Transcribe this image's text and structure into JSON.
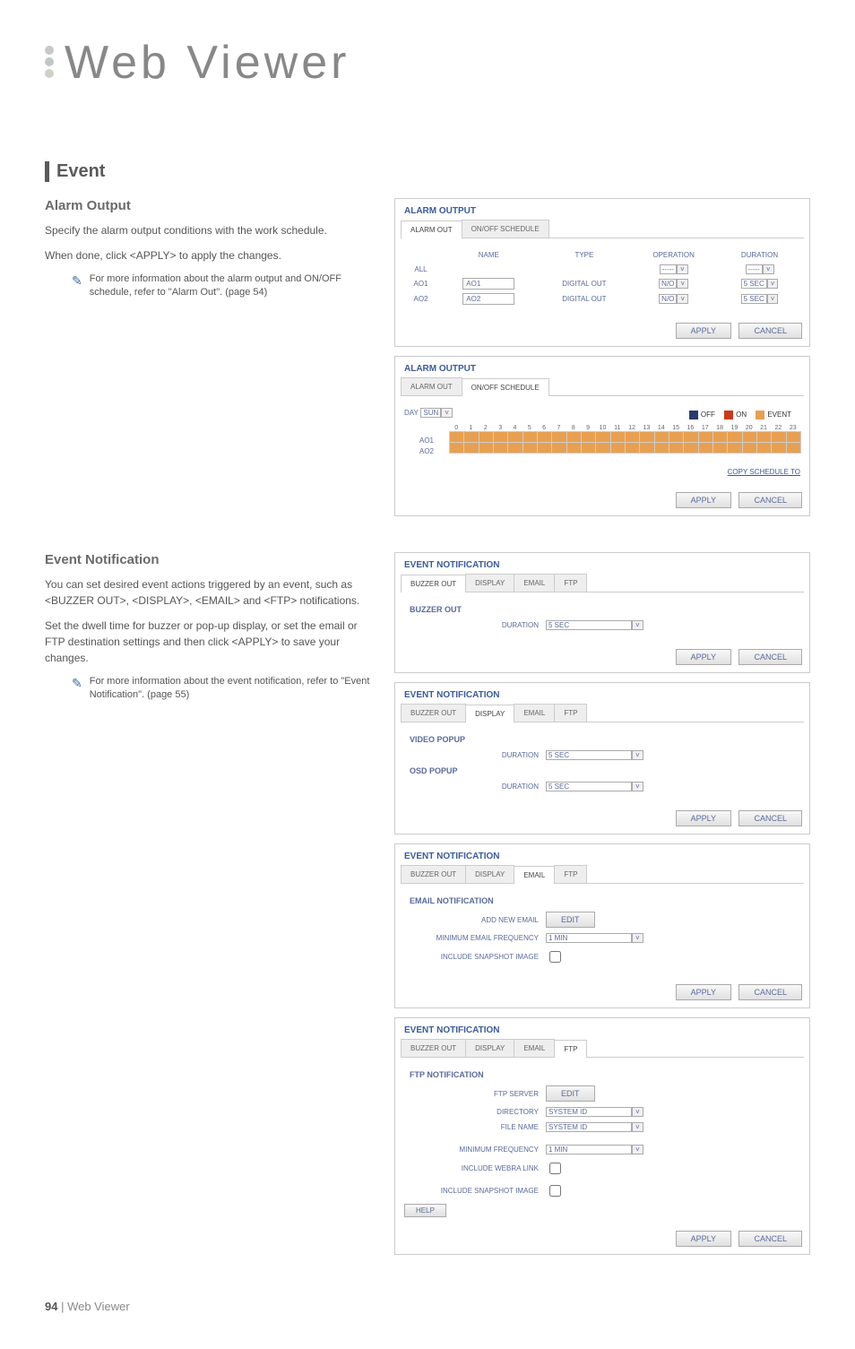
{
  "pageTitle": "Web Viewer",
  "event": {
    "heading": "Event",
    "alarmOutput": {
      "heading": "Alarm Output",
      "para1": "Specify the alarm output conditions with the work schedule.",
      "para2": "When done, click <APPLY> to apply the changes.",
      "note": "For more information about the alarm output and ON/OFF schedule, refer to \"Alarm Out\". (page 54)"
    },
    "eventNotification": {
      "heading": "Event Notification",
      "para1": "You can set desired event actions triggered by an event, such as <BUZZER OUT>, <DISPLAY>, <EMAIL> and <FTP> notifications.",
      "para2": "Set the dwell time for buzzer or pop-up display, or set the email or FTP destination settings and then click <APPLY> to save your changes.",
      "note": "For more information about the event notification, refer to \"Event Notification\". (page 55)"
    }
  },
  "panel1": {
    "title": "ALARM OUTPUT",
    "tabs": [
      "ALARM OUT",
      "ON/OFF SCHEDULE"
    ],
    "cols": [
      "NAME",
      "TYPE",
      "OPERATION",
      "DURATION"
    ],
    "rows": [
      {
        "id": "ALL",
        "name": "",
        "type": "",
        "op": "-----",
        "dur": "-----"
      },
      {
        "id": "AO1",
        "name": "AO1",
        "type": "DIGITAL OUT",
        "op": "N/O",
        "dur": "5 SEC"
      },
      {
        "id": "AO2",
        "name": "AO2",
        "type": "DIGITAL OUT",
        "op": "N/O",
        "dur": "5 SEC"
      }
    ],
    "apply": "APPLY",
    "cancel": "CANCEL"
  },
  "panel2": {
    "title": "ALARM OUTPUT",
    "tabs": [
      "ALARM OUT",
      "ON/OFF SCHEDULE"
    ],
    "dayLabel": "DAY",
    "dayValue": "SUN",
    "legend": {
      "off": "OFF",
      "on": "ON",
      "event": "EVENT"
    },
    "rows": [
      "AO1",
      "AO2"
    ],
    "copy": "COPY SCHEDULE TO",
    "apply": "APPLY",
    "cancel": "CANCEL"
  },
  "panel3": {
    "title": "EVENT NOTIFICATION",
    "tabs": [
      "BUZZER OUT",
      "DISPLAY",
      "EMAIL",
      "FTP"
    ],
    "section": "BUZZER OUT",
    "durationLabel": "DURATION",
    "durationValue": "5 SEC",
    "apply": "APPLY",
    "cancel": "CANCEL"
  },
  "panel4": {
    "title": "EVENT NOTIFICATION",
    "tabs": [
      "BUZZER OUT",
      "DISPLAY",
      "EMAIL",
      "FTP"
    ],
    "section1": "VIDEO POPUP",
    "section2": "OSD POPUP",
    "durationLabel": "DURATION",
    "durationValue": "5 SEC",
    "apply": "APPLY",
    "cancel": "CANCEL"
  },
  "panel5": {
    "title": "EVENT NOTIFICATION",
    "tabs": [
      "BUZZER OUT",
      "DISPLAY",
      "EMAIL",
      "FTP"
    ],
    "section": "EMAIL NOTIFICATION",
    "addNew": "ADD NEW EMAIL",
    "edit": "EDIT",
    "minFreq": "MINIMUM EMAIL FREQUENCY",
    "minFreqVal": "1 MIN",
    "snapshot": "INCLUDE SNAPSHOT IMAGE",
    "apply": "APPLY",
    "cancel": "CANCEL"
  },
  "panel6": {
    "title": "EVENT NOTIFICATION",
    "tabs": [
      "BUZZER OUT",
      "DISPLAY",
      "EMAIL",
      "FTP"
    ],
    "section": "FTP NOTIFICATION",
    "ftpServer": "FTP SERVER",
    "edit": "EDIT",
    "directory": "DIRECTORY",
    "fileName": "FILE NAME",
    "systemId": "SYSTEM ID",
    "minFreq": "MINIMUM FREQUENCY",
    "minFreqVal": "1 MIN",
    "webra": "INCLUDE WEBRA LINK",
    "snapshot": "INCLUDE SNAPSHOT IMAGE",
    "help": "HELP",
    "apply": "APPLY",
    "cancel": "CANCEL"
  },
  "footer": {
    "page": "94",
    "sep": " | ",
    "text": "Web Viewer"
  }
}
